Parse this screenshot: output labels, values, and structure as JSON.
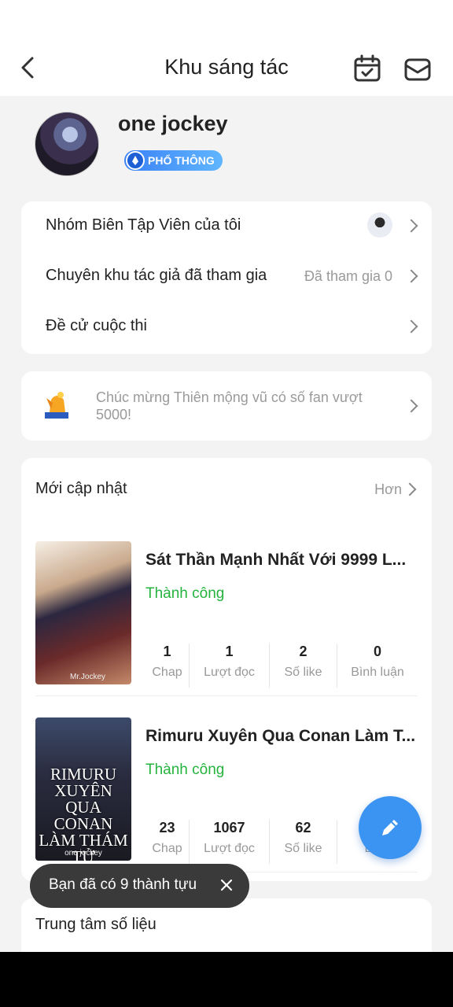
{
  "header": {
    "title": "Khu sáng tác"
  },
  "profile": {
    "username": "one jockey",
    "badge": "PHỔ THÔNG"
  },
  "menu": {
    "items": [
      {
        "label": "Nhóm Biên Tập Viên của tôi",
        "value": ""
      },
      {
        "label": "Chuyên khu tác giả đã tham gia",
        "value": "Đã tham gia 0"
      },
      {
        "label": "Đề cử cuộc thi",
        "value": ""
      }
    ]
  },
  "notice": {
    "message": "Chúc mừng Thiên mộng vũ có số fan vượt 5000!"
  },
  "updates": {
    "title": "Mới cập nhật",
    "more": "Hơn",
    "books": [
      {
        "title": "Sát Thần Mạnh Nhất Với 9999 L...",
        "status": "Thành công",
        "cover_text": "",
        "cover_author": "Mr.Jockey",
        "stats": [
          {
            "value": "1",
            "label": "Chap"
          },
          {
            "value": "1",
            "label": "Lượt đọc"
          },
          {
            "value": "2",
            "label": "Số like"
          },
          {
            "value": "0",
            "label": "Bình luận"
          }
        ]
      },
      {
        "title": "Rimuru Xuyên Qua Conan Làm T...",
        "status": "Thành công",
        "cover_text": "RIMURU XUYÊN QUA CONAN LÀM THÁM TỬ",
        "cover_author": "one jockey",
        "stats": [
          {
            "value": "23",
            "label": "Chap"
          },
          {
            "value": "1067",
            "label": "Lượt đọc"
          },
          {
            "value": "62",
            "label": "Số like"
          },
          {
            "value": "",
            "label": "Bình"
          }
        ]
      }
    ]
  },
  "data_center": {
    "title": "Trung tâm số liệu"
  },
  "toast": {
    "message": "Bạn đã có 9 thành tựu"
  }
}
